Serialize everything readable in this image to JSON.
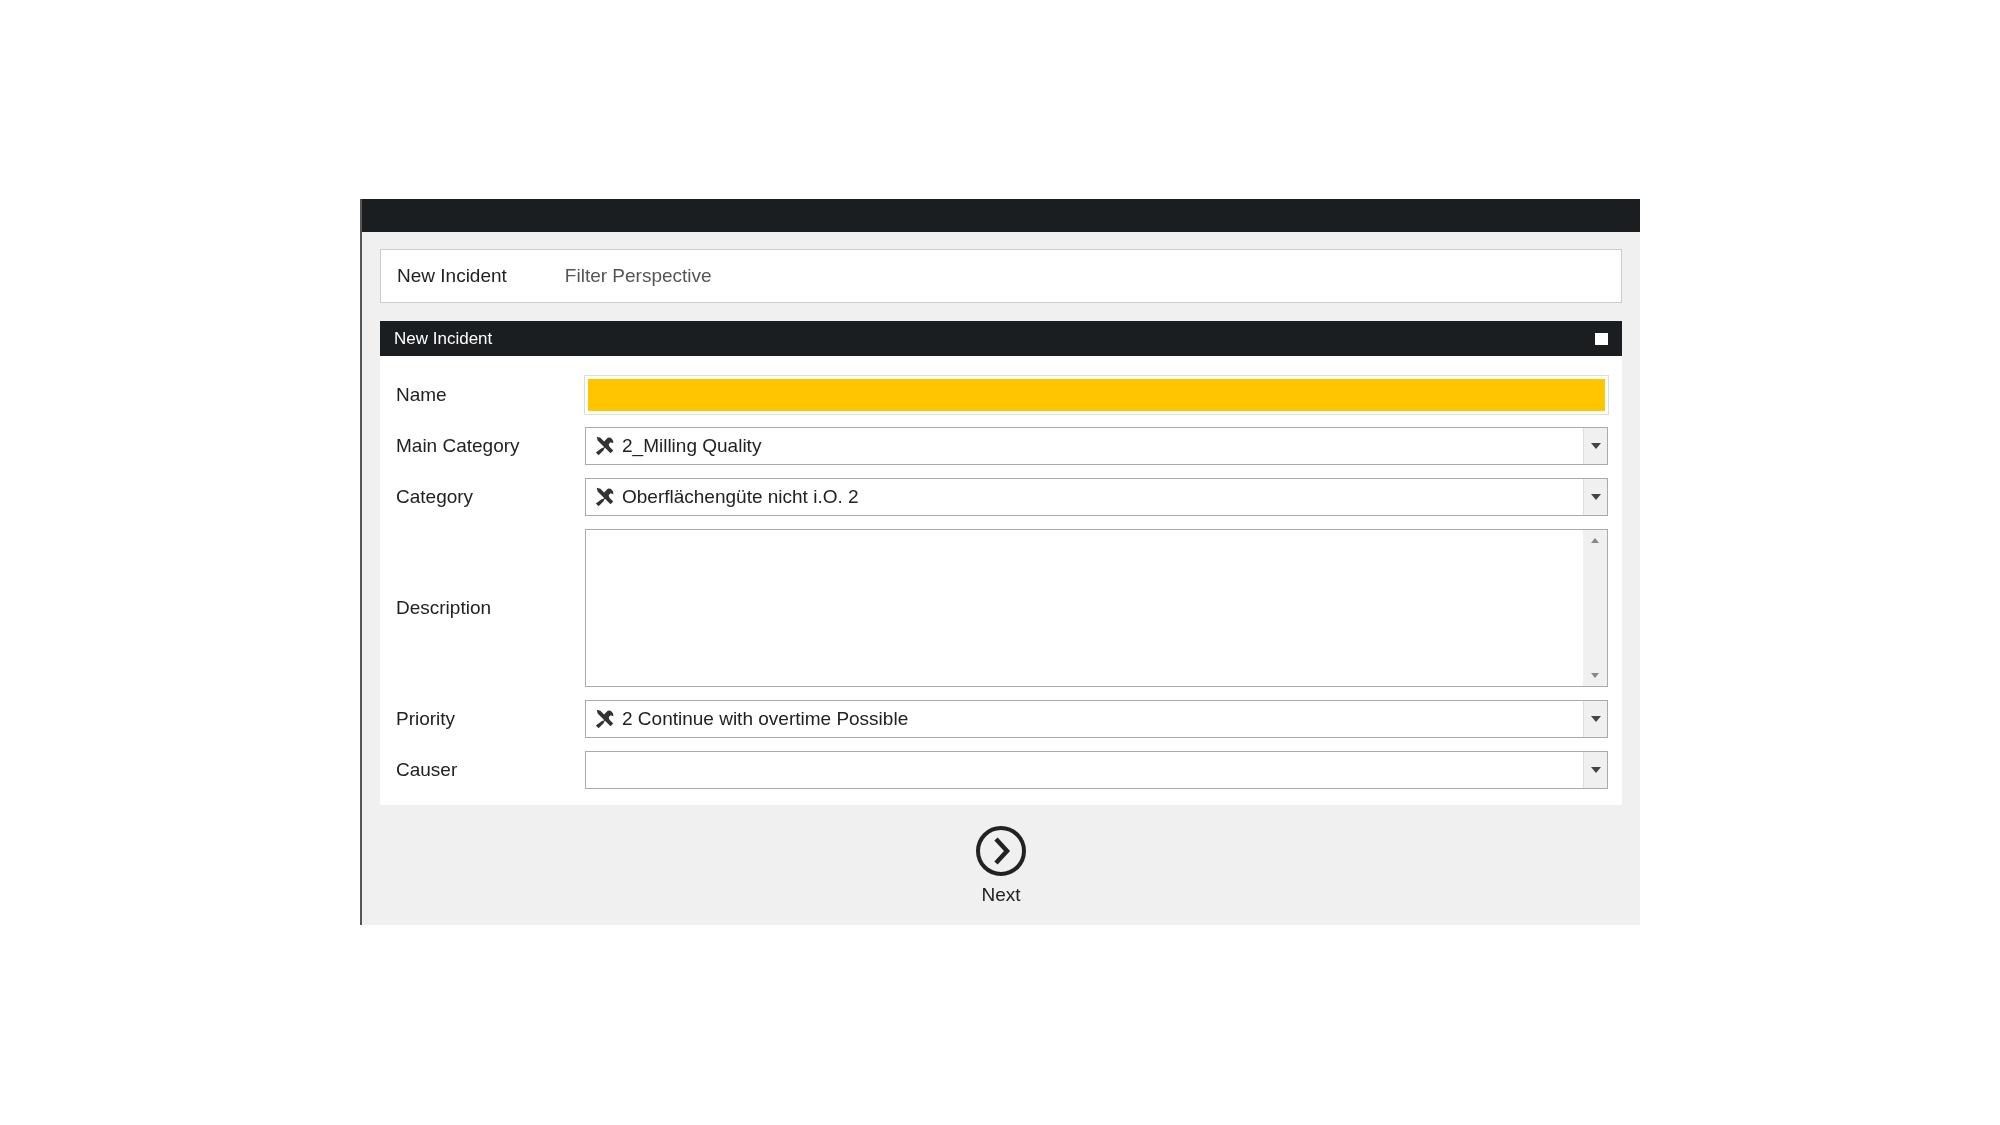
{
  "toolbar": {
    "title": "New Incident",
    "filter": "Filter Perspective"
  },
  "panel": {
    "title": "New Incident",
    "fields": [
      {
        "label": "Name",
        "kind": "text",
        "required": true
      },
      {
        "label": "Main Category",
        "kind": "dropdown",
        "value": "2_Milling Quality",
        "has_icon": true
      },
      {
        "label": "Category",
        "kind": "dropdown",
        "value": "Oberflächengüte nicht i.O. 2",
        "has_icon": true
      },
      {
        "label": "Description",
        "kind": "textarea"
      },
      {
        "label": "Priority",
        "kind": "dropdown",
        "value": "2 Continue with overtime Possible",
        "has_icon": true
      },
      {
        "label": "Causer",
        "kind": "dropdown",
        "has_icon": false
      }
    ]
  },
  "next_button": {
    "label": "Next"
  }
}
